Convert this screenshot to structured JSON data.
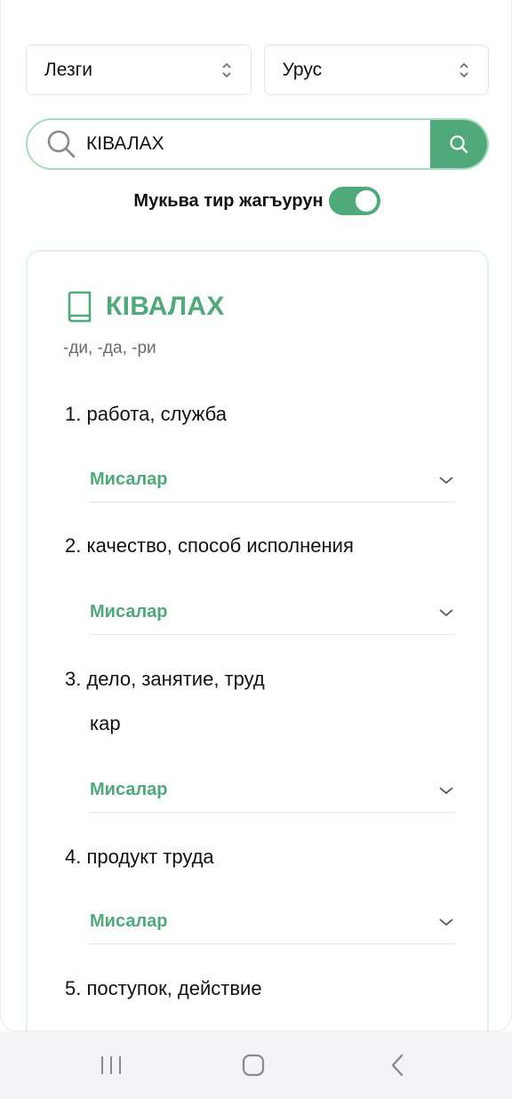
{
  "selects": {
    "source_language": "Лезги",
    "target_language": "Урус"
  },
  "search": {
    "value": "КIВАЛАХ",
    "placeholder": ""
  },
  "toggle": {
    "label": "Мукьва тир жагъурун",
    "state": "on"
  },
  "entry": {
    "headword": "КIВАЛАХ",
    "forms": "-ди, -да, -ри",
    "definitions": [
      {
        "number_text": "1. работа, служба",
        "sub": "",
        "examples_label": "Мисалар"
      },
      {
        "number_text": "2. качество, способ исполнения",
        "sub": "",
        "examples_label": "Мисалар"
      },
      {
        "number_text": "3. дело, занятие, труд",
        "sub": "кар",
        "examples_label": "Мисалар"
      },
      {
        "number_text": "4. продукт труда",
        "sub": "",
        "examples_label": "Мисалар"
      },
      {
        "number_text": "5. поступок, действие",
        "sub": "",
        "examples_label": ""
      }
    ]
  },
  "colors": {
    "accent": "#4fa97a",
    "search_border": "#a5dcbd",
    "card_border": "#e4f3ea"
  },
  "navbar": {
    "icons": [
      "recent-apps-icon",
      "home-icon",
      "back-icon"
    ]
  }
}
